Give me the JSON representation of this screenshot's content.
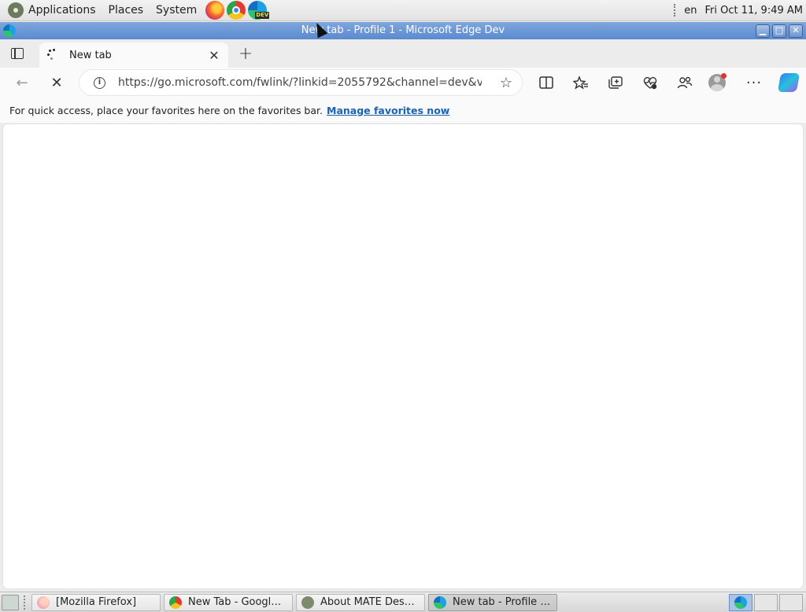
{
  "top_panel": {
    "menus": [
      "Applications",
      "Places",
      "System"
    ],
    "launchers": [
      "firefox-icon",
      "chrome-icon",
      "edge-dev-icon"
    ],
    "edge_badge": "DEV",
    "keyboard_layout": "en",
    "clock": "Fri Oct 11,  9:49 AM"
  },
  "window": {
    "title": "New tab - Profile 1 - Microsoft Edge Dev",
    "controls": [
      "minimize",
      "maximize",
      "close"
    ]
  },
  "tabs": [
    {
      "title": "New tab",
      "loading": true
    }
  ],
  "toolbar": {
    "url": "https://go.microsoft.com/fwlink/?linkid=2055792&channel=dev&v...",
    "back_icon": "back-arrow-icon",
    "stop_icon": "stop-icon"
  },
  "favorites_bar": {
    "message": "For quick access, place your favorites here on the favorites bar.",
    "link": "Manage favorites now"
  },
  "taskbar": {
    "tasks": [
      {
        "label": "[Mozilla Firefox]",
        "icon": "firefox-icon"
      },
      {
        "label": "New Tab - Google ...",
        "icon": "chrome-icon"
      },
      {
        "label": "About MATE Deskto...",
        "icon": "mate-icon"
      },
      {
        "label": "New tab - Profile 1 -...",
        "icon": "edge-icon",
        "active": true
      }
    ]
  }
}
